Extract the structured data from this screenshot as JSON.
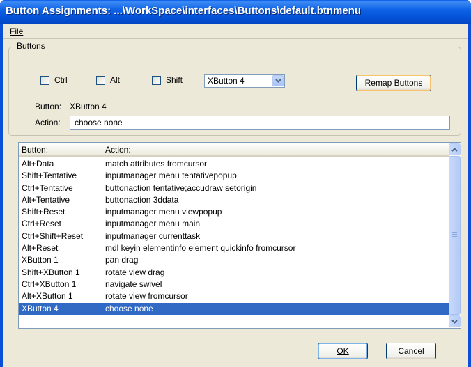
{
  "window": {
    "title": "Button Assignments:  ...\\WorkSpace\\interfaces\\Buttons\\default.btnmenu"
  },
  "menu": {
    "file": "File"
  },
  "group": {
    "legend": "Buttons",
    "ctrl_label": "Ctrl",
    "alt_label": "Alt",
    "shift_label": "Shift",
    "button_select_value": "XButton 4",
    "remap_label": "Remap Buttons",
    "button_label": "Button:",
    "button_value": "XButton 4",
    "action_label": "Action:",
    "action_value": "choose none"
  },
  "list": {
    "col_button": "Button:",
    "col_action": "Action:",
    "rows": [
      {
        "button": "Alt+Data",
        "action": "match attributes fromcursor"
      },
      {
        "button": "Shift+Tentative",
        "action": "inputmanager menu tentativepopup"
      },
      {
        "button": "Ctrl+Tentative",
        "action": "buttonaction tentative;accudraw setorigin"
      },
      {
        "button": "Alt+Tentative",
        "action": "buttonaction 3ddata"
      },
      {
        "button": "Shift+Reset",
        "action": "inputmanager menu viewpopup"
      },
      {
        "button": "Ctrl+Reset",
        "action": "inputmanager menu main"
      },
      {
        "button": "Ctrl+Shift+Reset",
        "action": "inputmanager currenttask"
      },
      {
        "button": "Alt+Reset",
        "action": "mdl keyin elementinfo element quickinfo fromcursor"
      },
      {
        "button": "XButton 1",
        "action": "pan drag"
      },
      {
        "button": "Shift+XButton 1",
        "action": "rotate view drag"
      },
      {
        "button": "Ctrl+XButton 1",
        "action": "navigate swivel"
      },
      {
        "button": "Alt+XButton 1",
        "action": "rotate view fromcursor"
      },
      {
        "button": "XButton 4",
        "action": "choose none"
      }
    ]
  },
  "footer": {
    "ok_label": "OK",
    "cancel_label": "Cancel"
  },
  "colors": {
    "title_blue": "#0554d9",
    "dialog_bg": "#ece9d8",
    "selection": "#316ac5"
  }
}
